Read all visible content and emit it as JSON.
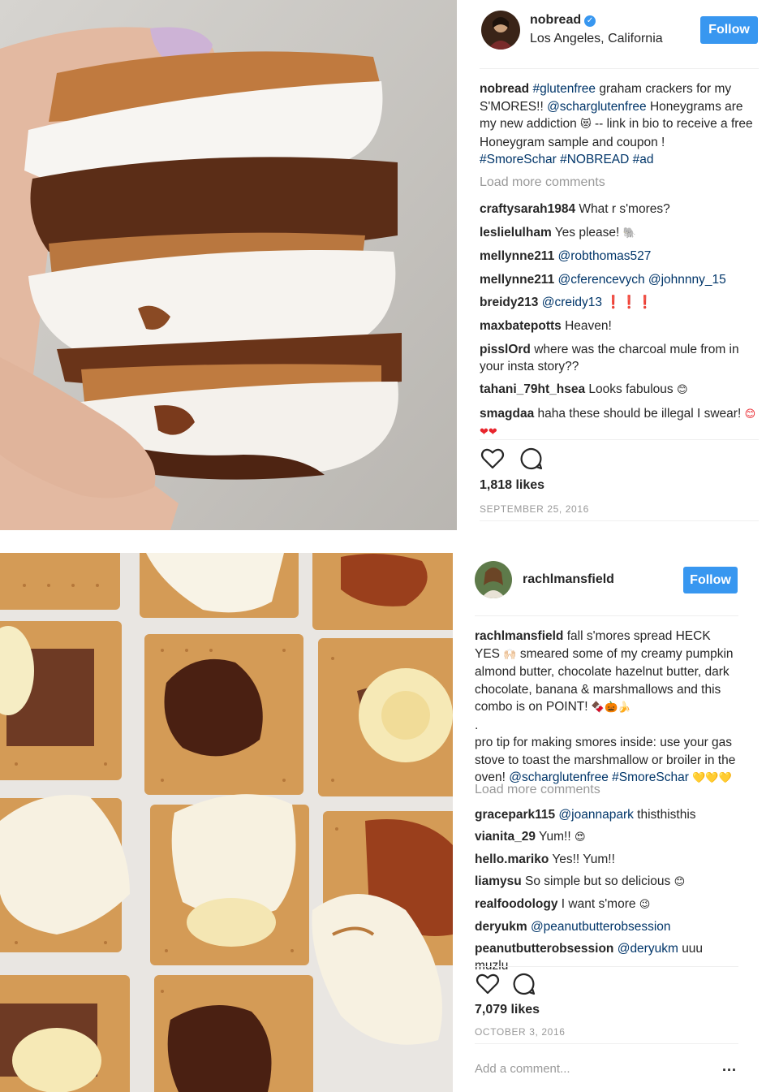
{
  "post1": {
    "username": "nobread",
    "verified_icon": "verified-badge-icon",
    "location": "Los Angeles, California",
    "follow_label": "Follow",
    "caption": {
      "username": "nobread",
      "part1": "graham crackers for my S'MORES!!",
      "hashtag1": "#glutenfree",
      "mention": "@scharglutenfree",
      "part2": "Honeygrams are my new addiction",
      "emoji1": "😻",
      "part3": "-- link in bio to receive a free Honeygram sample and coupon !",
      "hashtags": "#SmoreSchar #NOBREAD #ad"
    },
    "load_more": "Load more comments",
    "comments": [
      {
        "user": "craftysarah1984",
        "text": "What r s'mores?"
      },
      {
        "user": "leslielulham",
        "text": "Yes please!",
        "emoji": "🐘"
      },
      {
        "user": "mellynne211",
        "mention": "@robthomas527"
      },
      {
        "user": "mellynne211",
        "mention": "@cferencevych @johnnny_15"
      },
      {
        "user": "breidy213",
        "mention": "@creidy13",
        "emoji": "❗❗❗"
      },
      {
        "user": "maxbatepotts",
        "text": "Heaven!"
      },
      {
        "user": "pisslOrd",
        "text": "where was the charcoal mule from in your insta story??"
      },
      {
        "user": "tahani_79ht_hsea",
        "text": "Looks fabulous",
        "emoji": "😊"
      },
      {
        "user": "smagdaa",
        "text": "haha these should be illegal I swear!",
        "emoji": "😊❤❤"
      }
    ],
    "likes": "1,818 likes",
    "date": "SEPTEMBER 25, 2016"
  },
  "post2": {
    "username": "rachlmansfield",
    "follow_label": "Follow",
    "caption": {
      "username": "rachlmansfield",
      "part1": "fall s'mores spread HECK YES",
      "emoji1": "🙌🏻",
      "part2": "smeared some of my creamy pumpkin almond butter, chocolate hazelnut butter, dark chocolate, banana & marshmallows and this combo is on POINT!",
      "emoji2": "🍫🎃🍌",
      "dot": ".",
      "part3": "pro tip for making smores inside: use your gas stove to toast the marshmallow or broiler in the oven!",
      "mention": "@scharglutenfree",
      "hashtag": "#SmoreSchar",
      "emoji3": "💛💛💛"
    },
    "load_more": "Load more comments",
    "comments": [
      {
        "user": "gracepark115",
        "mention": "@joannapark",
        "text": "thisthisthis"
      },
      {
        "user": "vianita_29",
        "text": "Yum!!",
        "emoji": "😍"
      },
      {
        "user": "hello.mariko",
        "text": "Yes!! Yum!!"
      },
      {
        "user": "liamysu",
        "text": "So simple but so delicious",
        "emoji": "😊"
      },
      {
        "user": "realfoodology",
        "text": "I want s'more",
        "emoji": "😉"
      },
      {
        "user": "deryukm",
        "mention": "@peanutbutterobsession"
      },
      {
        "user": "peanutbutterobsession",
        "mention": "@deryukm",
        "text": "uuu muzlu"
      }
    ],
    "likes": "7,079 likes",
    "date": "OCTOBER 3, 2016",
    "add_comment_placeholder": "Add a comment...",
    "more_label": "..."
  },
  "icons": {
    "like": "heart-icon",
    "comment": "comment-bubble-icon",
    "more": "more-options-icon"
  },
  "colors": {
    "follow_button": "#3897f0",
    "link": "#003569",
    "muted": "#999999",
    "text": "#262626"
  }
}
